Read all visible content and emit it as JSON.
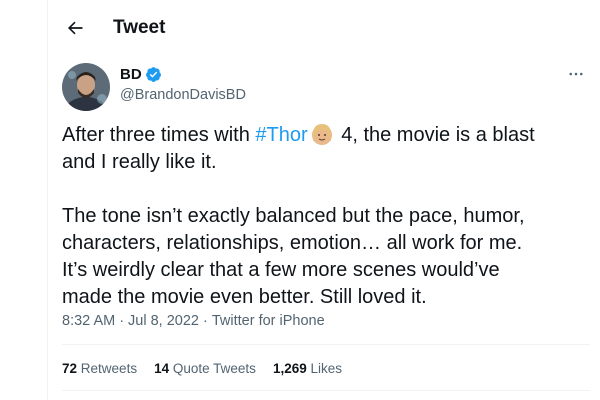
{
  "header": {
    "title": "Tweet",
    "back_icon": "arrow-left-icon"
  },
  "author": {
    "name": "BD",
    "handle": "@BrandonDavisBD",
    "verified": true,
    "verified_color": "#1d9bf0"
  },
  "more_icon": "more-horizontal-icon",
  "tweet": {
    "line1_before": "After three times with ",
    "hashtag": "#Thor",
    "line1_after": " 4, the movie is a blast",
    "line2": "and I really like it.",
    "para2_lines": [
      "The tone isn’t exactly balanced but the pace, humor,",
      "characters, relationships, emotion… all work for me.",
      "It’s weirdly clear that a few more scenes would’ve",
      "made the movie even better. Still loved it."
    ]
  },
  "meta": {
    "time": "8:32 AM",
    "sep1": "·",
    "date": "Jul 8, 2022",
    "sep2": "·",
    "source": "Twitter for iPhone"
  },
  "stats": [
    {
      "count": "72",
      "label": "Retweets"
    },
    {
      "count": "14",
      "label": "Quote Tweets"
    },
    {
      "count": "1,269",
      "label": "Likes"
    }
  ],
  "colors": {
    "accent": "#1d9bf0",
    "text": "#0f1419",
    "muted": "#536471",
    "divider": "#eff3f4"
  }
}
